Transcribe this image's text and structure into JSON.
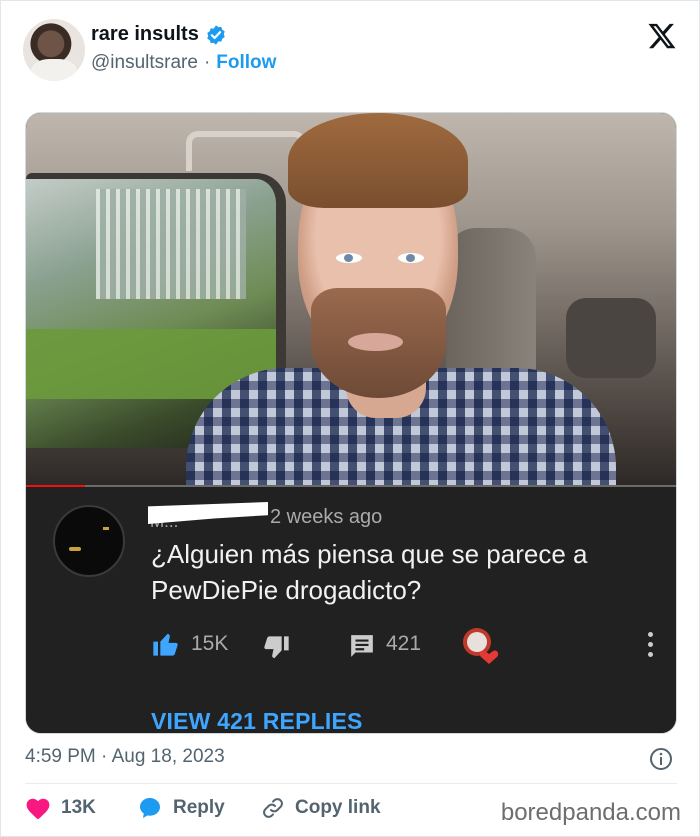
{
  "user": {
    "name": "rare insults",
    "handle": "@insultsrare",
    "separator": "·",
    "follow_label": "Follow"
  },
  "media": {
    "comment": {
      "redacted_name": "M...",
      "time_ago": "2 weeks ago",
      "text": "¿Alguien más piensa que se parece a PewDiePie drogadicto?",
      "like_count": "15K",
      "reply_count": "421",
      "view_replies": "VIEW 421 REPLIES"
    },
    "progress": 0.09
  },
  "meta": {
    "timestamp": "4:59 PM · Aug 18, 2023"
  },
  "footer": {
    "like_count": "13K",
    "reply_label": "Reply",
    "copy_label": "Copy link"
  },
  "watermark": "boredpanda.com",
  "colors": {
    "accent": "#1d9bf0",
    "like": "#f91880",
    "yt_link": "#3ea6ff",
    "yt_bg": "#212121"
  },
  "icons": [
    "verified-icon",
    "x-logo-icon",
    "thumbs-up-icon",
    "thumbs-down-icon",
    "reply-icon",
    "creator-heart-icon",
    "more-vertical-icon",
    "info-icon",
    "heart-icon",
    "speech-bubble-icon",
    "link-icon"
  ]
}
